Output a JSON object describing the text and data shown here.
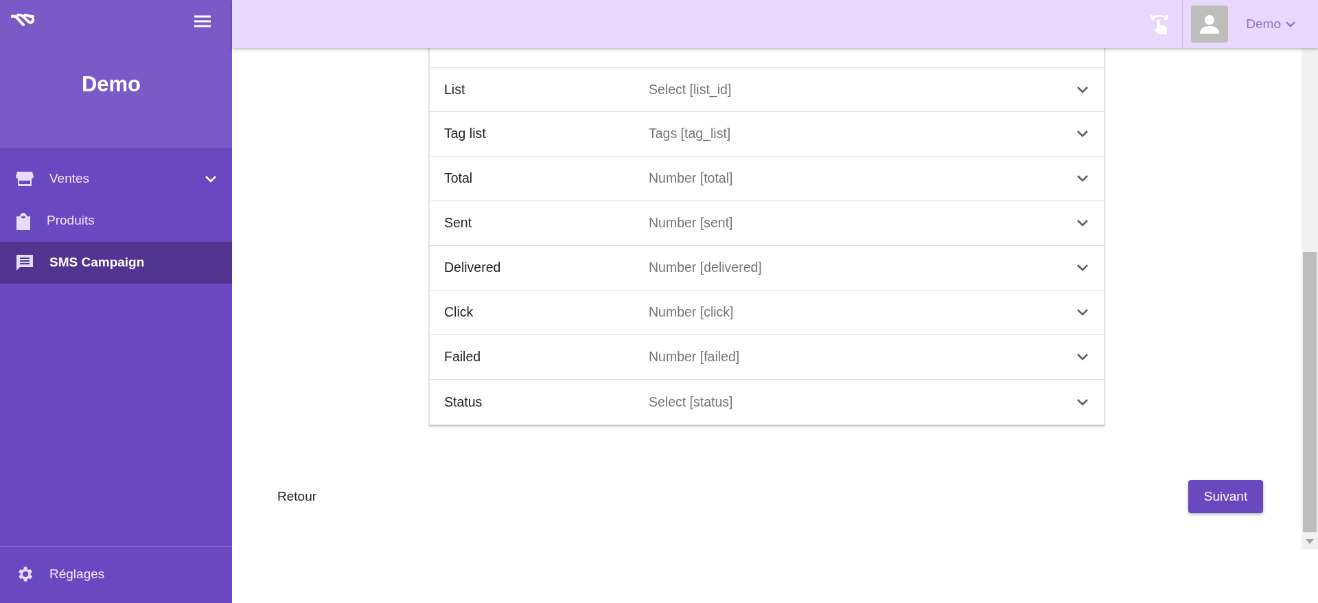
{
  "sidebar": {
    "title": "Demo",
    "items": [
      {
        "label": "Ventes",
        "kind": "group",
        "expanded": false,
        "selected": false
      },
      {
        "label": "Produits",
        "kind": "link",
        "selected": false
      },
      {
        "label": "SMS Campaign",
        "kind": "link",
        "selected": true
      }
    ],
    "footer_item": {
      "label": "Réglages"
    }
  },
  "header": {
    "user": "Demo"
  },
  "fields": [
    {
      "label": "List",
      "placeholder": "Select [list_id]"
    },
    {
      "label": "Tag list",
      "placeholder": "Tags [tag_list]"
    },
    {
      "label": "Total",
      "placeholder": "Number [total]"
    },
    {
      "label": "Sent",
      "placeholder": "Number [sent]"
    },
    {
      "label": "Delivered",
      "placeholder": "Number [delivered]"
    },
    {
      "label": "Click",
      "placeholder": "Number [click]"
    },
    {
      "label": "Failed",
      "placeholder": "Number [failed]"
    },
    {
      "label": "Status",
      "placeholder": "Select [status]"
    }
  ],
  "buttons": {
    "back": "Retour",
    "next": "Suivant"
  }
}
